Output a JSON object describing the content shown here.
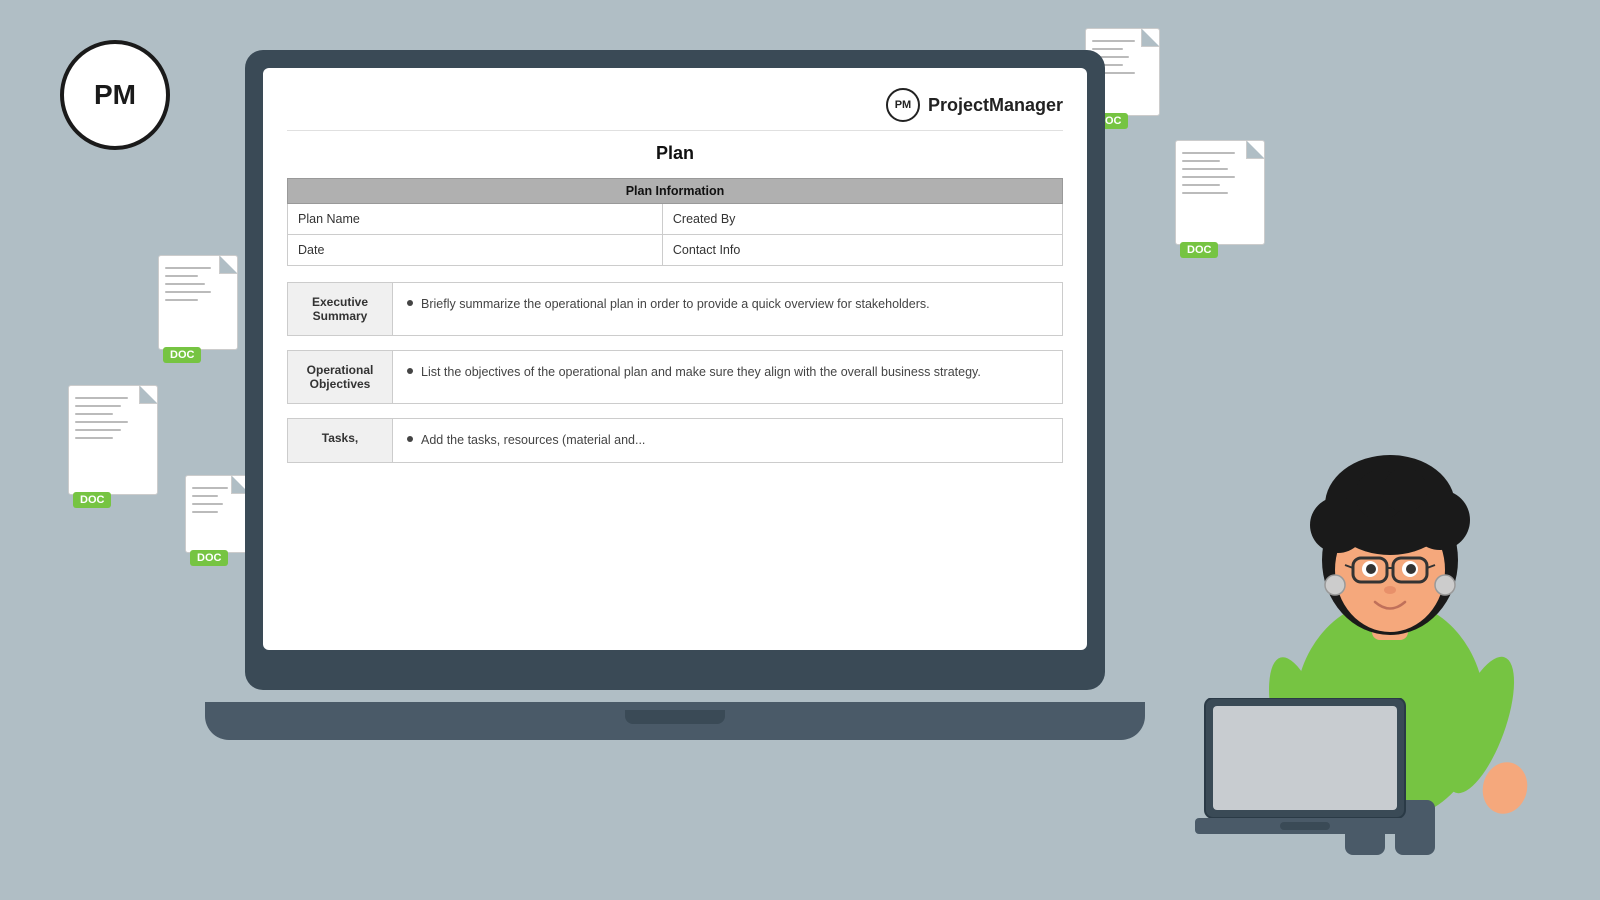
{
  "brand": {
    "logo_text": "PM",
    "brand_name": "ProjectManager"
  },
  "doc_badges": {
    "label": "DOC"
  },
  "document": {
    "title": "Plan",
    "plan_info_header": "Plan Information",
    "fields": {
      "plan_name": "Plan Name",
      "created_by": "Created By",
      "date": "Date",
      "contact_info": "Contact Info"
    },
    "sections": [
      {
        "label": "Executive\nSummary",
        "content": "Briefly summarize the operational plan in order to provide a quick overview for stakeholders."
      },
      {
        "label": "Operational\nObjectives",
        "content": "List the objectives of the operational plan and make sure they align with the overall business strategy."
      },
      {
        "label": "Tasks,",
        "content": "Add the tasks, resources (material and..."
      }
    ]
  },
  "colors": {
    "doc_badge": "#76c442",
    "background": "#b0bec5",
    "laptop_body": "#3a4a56",
    "table_header_bg": "#b0b0b0",
    "section_label_bg": "#f0f0f0"
  }
}
